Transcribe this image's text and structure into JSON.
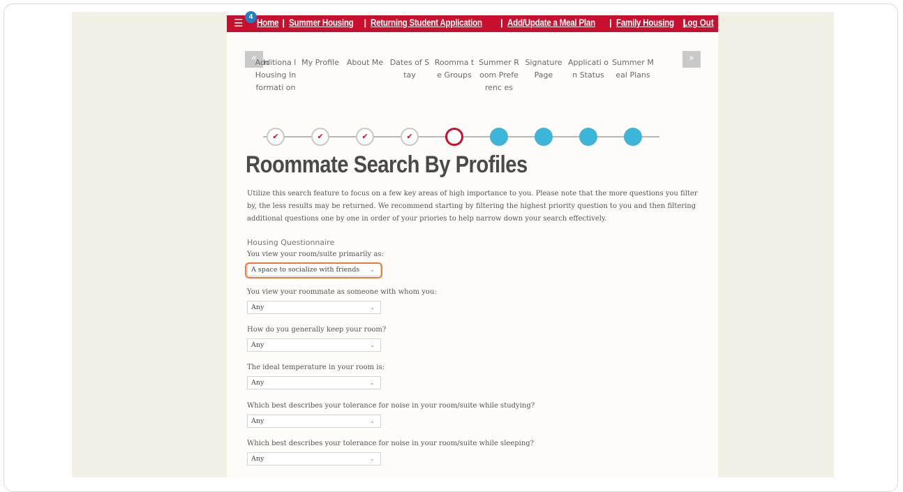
{
  "nav": {
    "badge": "4",
    "links": [
      "Home",
      "Summer Housing",
      "Returning Student Application",
      "Add/Update a Meal Plan",
      "Family Housing"
    ],
    "separator": "|",
    "logout": "Log Out"
  },
  "steps": {
    "prev_arrow": "«",
    "next_arrow": "»",
    "cut_label": "n",
    "labels": [
      "Additiona l Housing Informati on",
      "My Profile",
      "About Me",
      "Dates of Stay",
      "Roomma te Groups",
      "Summer Room Preferenc es",
      "Signature Page",
      "Applicati on Status",
      "Summer Meal Plans"
    ],
    "status": [
      "done",
      "done",
      "done",
      "done",
      "current",
      "todo",
      "todo",
      "todo",
      "todo"
    ],
    "check": "✔"
  },
  "main": {
    "title": "Roommate Search By Profiles",
    "intro": "Utilize this search feature to focus on a few key areas of high importance to you. Please note that the more questions you filter by, the less results may be returned. We recommend starting by filtering the highest priority question to you and then filtering additional questions one by one in order of your priories to help narrow down your search effectively.",
    "section": "Housing Questionnaire",
    "questions": [
      {
        "label": "You view your room/suite primarily as:",
        "value": "A space to socialize with friends"
      },
      {
        "label": "You view your roommate as someone with whom you:",
        "value": "Any"
      },
      {
        "label": "How do you generally keep your room?",
        "value": "Any"
      },
      {
        "label": "The ideal temperature in your room is:",
        "value": "Any"
      },
      {
        "label": "Which best describes your tolerance for noise in your room/suite while studying?",
        "value": "Any"
      },
      {
        "label": "Which best describes your tolerance for noise in your room/suite while sleeping?",
        "value": "Any"
      }
    ],
    "chevron": "⌄"
  },
  "colors": {
    "nav": "#c8102e",
    "todo": "#3db5d8",
    "highlight": "#f07a3c"
  }
}
